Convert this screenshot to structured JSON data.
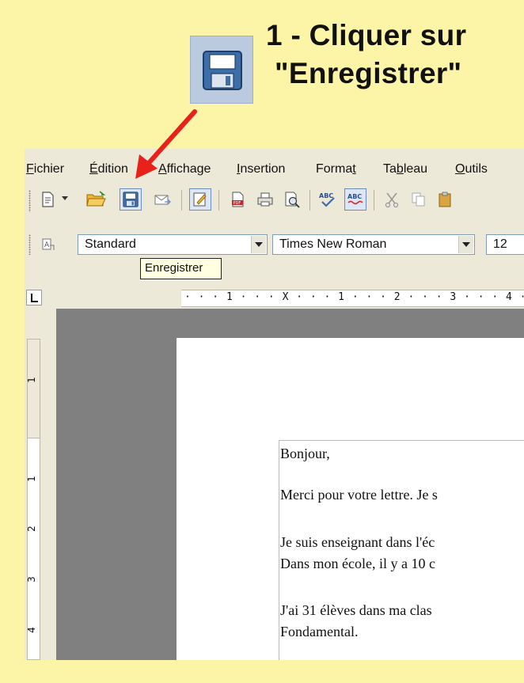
{
  "headline": {
    "line1": "1 - Cliquer sur",
    "line2": "\"Enregistrer\""
  },
  "menu": [
    {
      "label": "Fichier",
      "u": "F",
      "rest": "ichier"
    },
    {
      "label": "Édition",
      "u": "É",
      "rest": "dition"
    },
    {
      "label": "Affichage",
      "u": "A",
      "rest": "ffichage"
    },
    {
      "label": "Insertion",
      "u": "I",
      "rest": "nsertion"
    },
    {
      "label": "Format",
      "pre": "Forma",
      "u": "t",
      "rest": ""
    },
    {
      "label": "Tableau",
      "pre": "Ta",
      "u": "b",
      "rest": "leau"
    },
    {
      "label": "Outils",
      "u": "O",
      "rest": "utils"
    }
  ],
  "toolbar2": {
    "style_value": "Standard",
    "font_value": "Times New Roman",
    "size_value": "12"
  },
  "tooltip": "Enregistrer",
  "hruler": {
    "labels": "· · · 1 · · · X · · · 1 · · · 2 · · · 3 · · · 4 · ·"
  },
  "vruler": {
    "labels": [
      "1",
      "1",
      "2",
      "3",
      "4"
    ]
  },
  "document": {
    "paragraphs": [
      "Bonjour,",
      "Merci pour votre lettre. Je s",
      "Je suis enseignant dans l'éc",
      "Dans mon école, il y a 10 c",
      "J'ai 31 élèves dans ma clas",
      "Fondamental."
    ]
  },
  "colors": {
    "background": "#FCF5A7",
    "arrow": "#E8221B",
    "save_icon_bg": "#BCCAE0",
    "window": "#ECE9D8",
    "doc_area": "#808080"
  },
  "icons": [
    "floppy-save-icon",
    "new-document-icon",
    "open-folder-icon",
    "email-icon",
    "edit-mode-icon",
    "pdf-export-icon",
    "print-icon",
    "print-preview-icon",
    "spellcheck-icon",
    "autospellcheck-icon",
    "cut-icon",
    "copy-icon",
    "paste-icon",
    "paragraph-style-icon"
  ]
}
